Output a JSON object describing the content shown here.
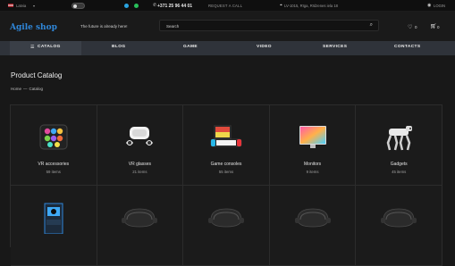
{
  "topbar": {
    "country": "Latvia",
    "phone": "+371 25 96 44 01",
    "request_call": "REQUEST A CALL",
    "address": "LV-1015, Rīga, Rīdzenes iela 18",
    "login": "LOGIN"
  },
  "header": {
    "logo": "Agile shop",
    "tagline": "The future is already here!",
    "search_placeholder": "Search",
    "wishlist_count": "0",
    "cart_count": "0"
  },
  "nav": {
    "catalog": "CATALOG",
    "items": [
      "BLOG",
      "GAME",
      "VIDEO",
      "SERVICES",
      "CONTACTS"
    ]
  },
  "page": {
    "title": "Product Catalog",
    "breadcrumb": [
      "Home",
      "Catalog"
    ]
  },
  "categories": [
    {
      "name": "VR accessories",
      "count": "59 items",
      "icon": "vr-accessories-image"
    },
    {
      "name": "VR glasses",
      "count": "21 items",
      "icon": "vr-glasses-image"
    },
    {
      "name": "Game consoles",
      "count": "55 items",
      "icon": "game-consoles-image"
    },
    {
      "name": "Monitors",
      "count": "9 items",
      "icon": "monitor-image"
    },
    {
      "name": "Gadgets",
      "count": "45 items",
      "icon": "robot-dog-image"
    },
    {
      "name": "",
      "count": "",
      "icon": "vr-arcade-machine-image"
    },
    {
      "name": "",
      "count": "",
      "icon": "vr-headset-image"
    },
    {
      "name": "",
      "count": "",
      "icon": "vr-headset-image"
    },
    {
      "name": "",
      "count": "",
      "icon": "vr-headset-image"
    },
    {
      "name": "",
      "count": "",
      "icon": "vr-headset-image"
    }
  ],
  "colors": {
    "accent": "#2f86d8",
    "nav_bg": "#2f333a",
    "page_bg": "#181818"
  }
}
